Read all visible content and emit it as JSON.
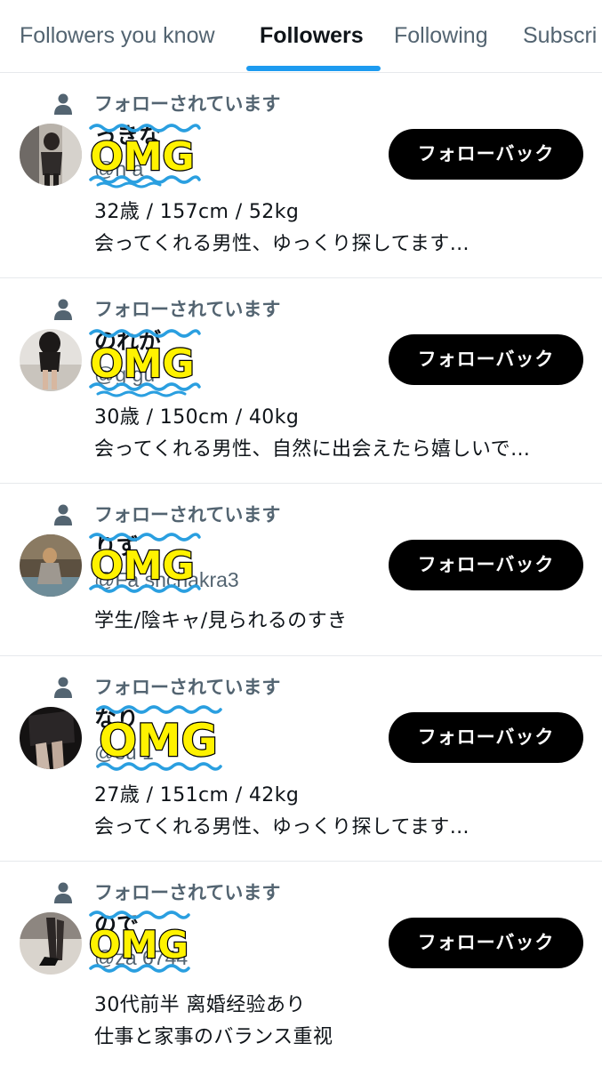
{
  "tabs": [
    {
      "label": "Followers you know"
    },
    {
      "label": "Followers"
    },
    {
      "label": "Following"
    },
    {
      "label": "Subscri"
    }
  ],
  "overlay": {
    "sticker_text": "OMG",
    "sticker_fill": "#fff200"
  },
  "colors": {
    "accent": "#1d9bf0",
    "muted": "#536471",
    "text": "#0f1419",
    "button": "#000000",
    "squiggle": "#2a9fe0"
  },
  "users": [
    {
      "context": "フォローされています",
      "name_visible": "っきな",
      "handle_visible": "@h        a",
      "follow_label": "フォローバック",
      "bio": [
        "32歳 / 157cm / 52kg",
        "会ってくれる男性、ゆっくり探してます…"
      ]
    },
    {
      "context": "フォローされています",
      "name_visible": "のれが",
      "handle_visible": "@g        gu",
      "follow_label": "フォローバック",
      "bio": [
        "30歳 / 150cm / 40kg",
        "会ってくれる男性、自然に出会えたら嬉しいで…"
      ]
    },
    {
      "context": "フォローされています",
      "name_visible": "りず",
      "handle_visible": "@Fa          shchakra3",
      "follow_label": "フォローバック",
      "bio": [
        "学生/陰キャ/見られるのすき"
      ]
    },
    {
      "context": "フォローされています",
      "name_visible": "なり",
      "handle_visible": "@su          1",
      "follow_label": "フォローバック",
      "bio": [
        "27歳 / 151cm / 42kg",
        "会ってくれる男性、ゆっくり探してます…"
      ]
    },
    {
      "context": "フォローされています",
      "name_visible": "ので",
      "handle_visible": "@za        6744",
      "follow_label": "フォローバック",
      "bio": [
        "30代前半 离婚经验あり",
        "仕事と家事のバランス重视"
      ]
    }
  ]
}
